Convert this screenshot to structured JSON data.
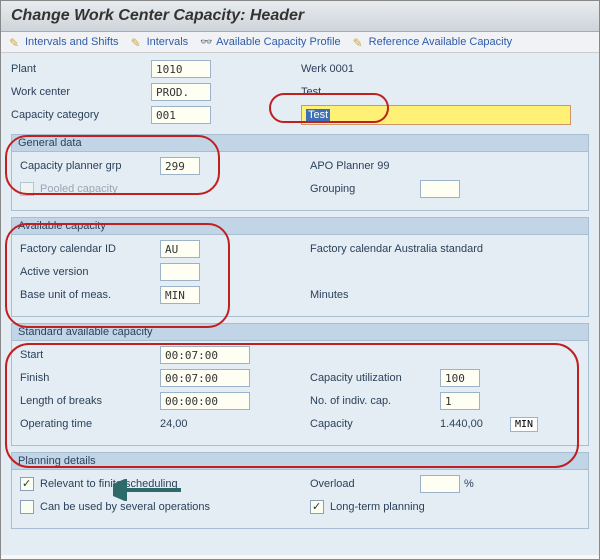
{
  "title": "Change Work Center Capacity: Header",
  "toolbar": {
    "intervals_shifts": "Intervals and Shifts",
    "intervals": "Intervals",
    "avail_profile": "Available Capacity Profile",
    "ref_avail": "Reference Available Capacity"
  },
  "header": {
    "plant_label": "Plant",
    "plant_value": "1010",
    "plant_desc": "Werk 0001",
    "wc_label": "Work center",
    "wc_value": "PROD.",
    "wc_desc": "Test",
    "cc_label": "Capacity category",
    "cc_value": "001",
    "cc_desc": "Test"
  },
  "general": {
    "title": "General data",
    "cpg_label": "Capacity planner grp",
    "cpg_value": "299",
    "cpg_desc": "APO Planner 99",
    "pooled_label": "Pooled capacity",
    "grouping_label": "Grouping"
  },
  "available": {
    "title": "Available capacity",
    "fcal_label": "Factory calendar ID",
    "fcal_value": "AU",
    "fcal_desc": "Factory calendar Australia standard",
    "av_label": "Active version",
    "uom_label": "Base unit of meas.",
    "uom_value": "MIN",
    "uom_desc": "Minutes"
  },
  "standard": {
    "title": "Standard available capacity",
    "start_label": "Start",
    "start_value": "00:07:00",
    "finish_label": "Finish",
    "finish_value": "00:07:00",
    "util_label": "Capacity utilization",
    "util_value": "100",
    "breaks_label": "Length of breaks",
    "breaks_value": "00:00:00",
    "indiv_label": "No. of indiv. cap.",
    "indiv_value": "1",
    "optime_label": "Operating time",
    "optime_value": "24,00",
    "cap_label": "Capacity",
    "cap_value": "1.440,00",
    "cap_unit": "MIN"
  },
  "planning": {
    "title": "Planning details",
    "finite_label": "Relevant to finite scheduling",
    "overload_label": "Overload",
    "overload_unit": "%",
    "several_label": "Can be used by several operations",
    "longterm_label": "Long-term planning"
  }
}
